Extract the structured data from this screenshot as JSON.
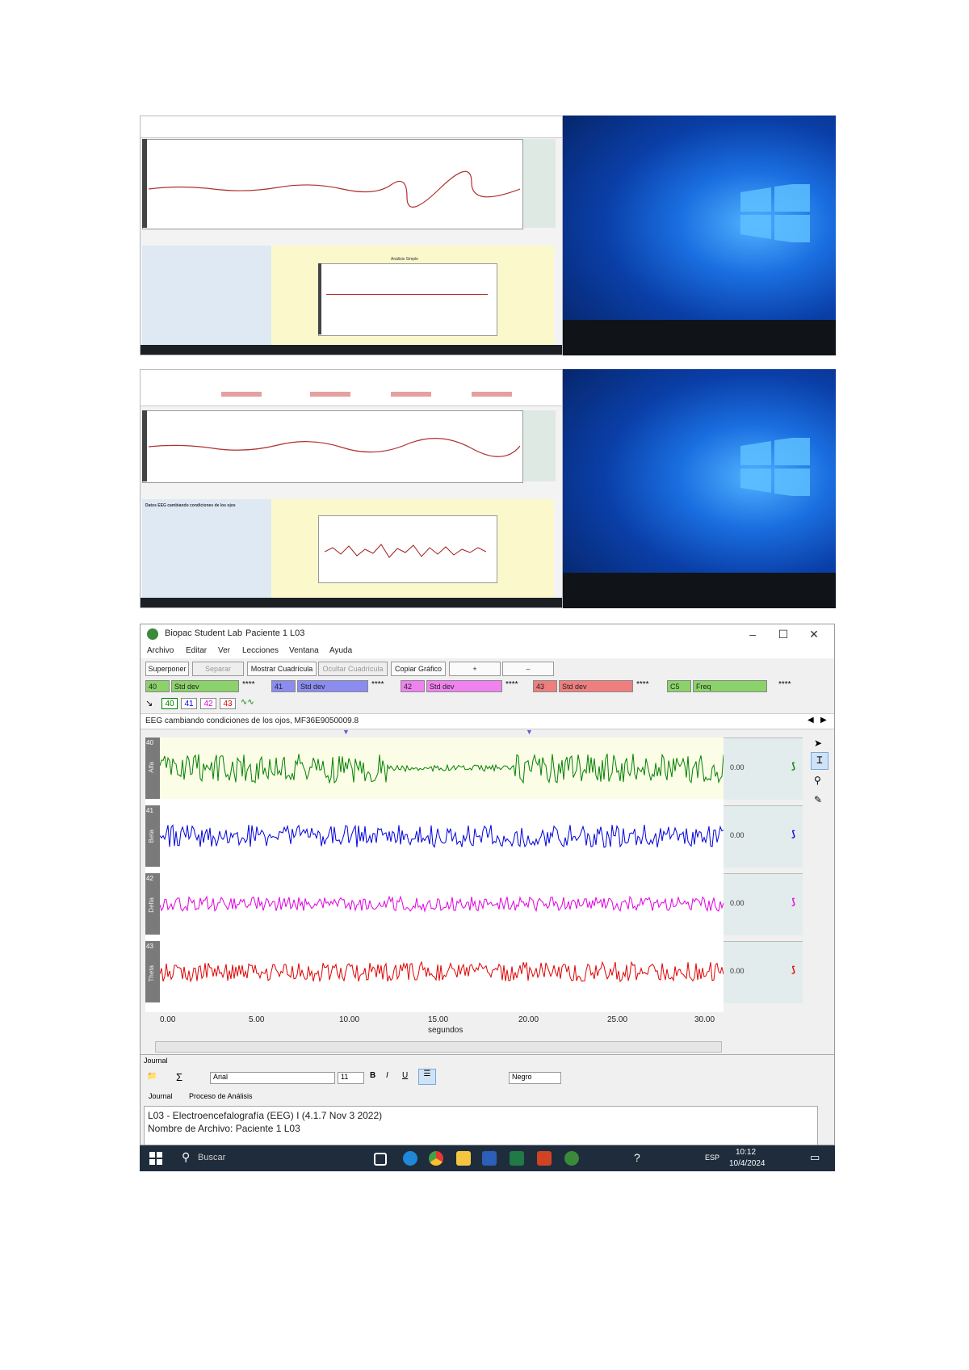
{
  "main_window": {
    "title": "Biopac Student Lab",
    "file_title": "Paciente 1 L03",
    "menu": [
      "Archivo",
      "Editar",
      "Ver",
      "Lecciones",
      "Ventana",
      "Ayuda"
    ],
    "toolbar": [
      "Superponer",
      "Separar",
      "Mostrar Cuadrícula",
      "Ocultar Cuadrícula",
      "Copiar Gráfico"
    ],
    "channels": [
      {
        "id": "40",
        "func": "Std dev",
        "color": "#8bd26b"
      },
      {
        "id": "41",
        "func": "Std dev",
        "color": "#8a8cf0"
      },
      {
        "id": "42",
        "func": "Std dev",
        "color": "#ef82ef"
      },
      {
        "id": "43",
        "func": "Std dev",
        "color": "#ef7e7e"
      },
      {
        "id": "C5",
        "func": "Freq",
        "color": "#8bd26b"
      }
    ],
    "stars": "****",
    "tags": [
      "40",
      "41",
      "42",
      "43"
    ],
    "segment_label": "EEG cambiando condiciones de los ojos, MF36E9050009.8",
    "channel_rows": [
      {
        "num": "40",
        "name": "Alfa",
        "value": "0.00",
        "color": "#008000"
      },
      {
        "num": "41",
        "name": "Beta",
        "value": "0.00",
        "color": "#0000dd"
      },
      {
        "num": "42",
        "name": "Delta",
        "value": "0.00",
        "color": "#e000e0"
      },
      {
        "num": "43",
        "name": "Theta",
        "value": "0.00",
        "color": "#e00000"
      }
    ],
    "x_ticks": [
      "0.00",
      "5.00",
      "10.00",
      "15.00",
      "20.00",
      "25.00",
      "30.00"
    ],
    "x_label": "segundos",
    "journal_label": "Journal",
    "font_name": "Arial",
    "font_size": "11",
    "font_color": "Negro",
    "journal_tabs": [
      "Journal",
      "Proceso de Análisis"
    ],
    "journal_lines": [
      "L03 - Electroencefalografía (EEG) I (4.1.7 Nov 3 2022)",
      "Nombre de Archivo: Paciente 1 L03"
    ]
  },
  "taskbar": {
    "search": "Buscar",
    "lang": "ESP",
    "time": "10:12",
    "date": "10/4/2024"
  },
  "thumbnails": {
    "thumb1_title": "Análisis Simple",
    "thumb2_title": "Datos EEG cambiando condiciones de los ojos"
  }
}
